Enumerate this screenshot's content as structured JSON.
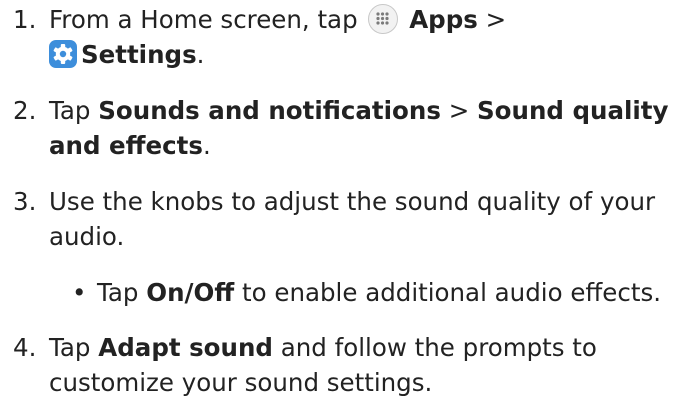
{
  "steps": [
    {
      "number": "1.",
      "line1_prefix": "From a Home screen, tap",
      "apps_icon": "apps-grid-icon",
      "apps_label": "Apps",
      "sep": ">",
      "settings_icon": "gear-icon",
      "settings_label": "Settings",
      "end": "."
    },
    {
      "number": "2.",
      "prefix": "Tap",
      "item1": "Sounds and notifications",
      "sep": ">",
      "item2a": "Sound quality",
      "item2b": "and effects",
      "end": "."
    },
    {
      "number": "3.",
      "line1": "Use the knobs to adjust the sound quality of your",
      "line2": "audio.",
      "bullet": {
        "prefix": "Tap",
        "bold": "On/Off",
        "suffix": "to enable additional audio effects."
      }
    },
    {
      "number": "4.",
      "prefix": "Tap",
      "bold": "Adapt sound",
      "line1_suffix": "and follow the prompts to",
      "line2": "customize your sound settings."
    }
  ],
  "colors": {
    "text": "#222222",
    "settings_icon_bg": "#3d8edb"
  }
}
